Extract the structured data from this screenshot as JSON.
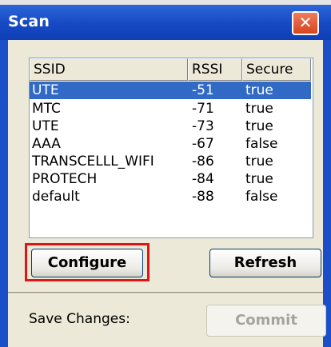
{
  "window": {
    "title": "Scan",
    "close_glyph": "✕"
  },
  "list": {
    "columns": [
      "SSID",
      "RSSI",
      "Secure"
    ],
    "rows": [
      {
        "ssid": "UTE",
        "rssi": "-51",
        "secure": "true",
        "selected": true
      },
      {
        "ssid": "MTC",
        "rssi": "-71",
        "secure": "true",
        "selected": false
      },
      {
        "ssid": "UTE",
        "rssi": "-73",
        "secure": "true",
        "selected": false
      },
      {
        "ssid": "AAA",
        "rssi": "-67",
        "secure": "false",
        "selected": false
      },
      {
        "ssid": "TRANSCELLL_WIFI",
        "rssi": "-86",
        "secure": "true",
        "selected": false
      },
      {
        "ssid": "PROTECH",
        "rssi": "-84",
        "secure": "true",
        "selected": false
      },
      {
        "ssid": "default",
        "rssi": "-88",
        "secure": "false",
        "selected": false
      }
    ]
  },
  "buttons": {
    "configure": "Configure",
    "refresh": "Refresh",
    "commit": "Commit"
  },
  "footer": {
    "save_label": "Save Changes:"
  },
  "colors": {
    "titlebar": "#1649c4",
    "selection": "#316ac5",
    "highlight": "#e01515"
  }
}
